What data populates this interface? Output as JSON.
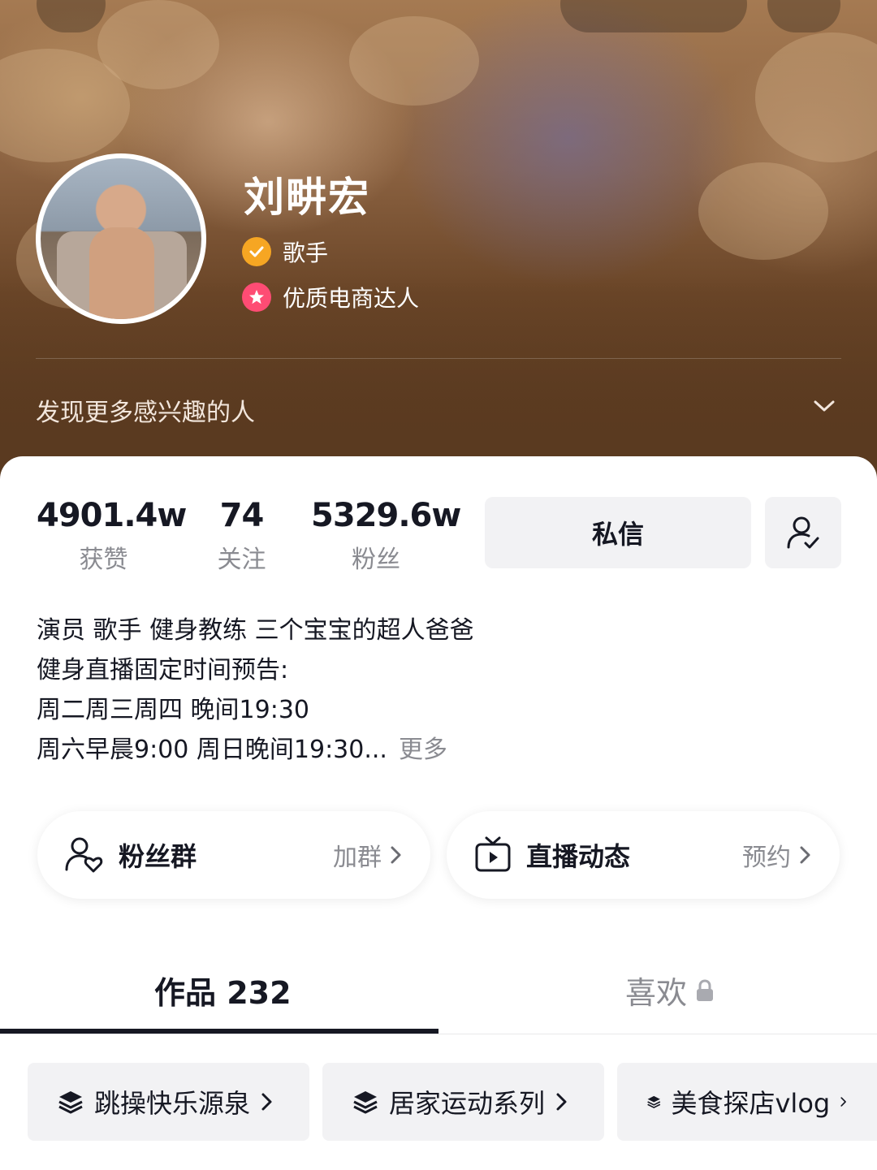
{
  "profile": {
    "name": "刘畊宏",
    "tags": [
      "歌手",
      "优质电商达人"
    ],
    "discover_label": "发现更多感兴趣的人"
  },
  "stats": [
    {
      "value": "4901.4w",
      "label": "获赞"
    },
    {
      "value": "74",
      "label": "关注"
    },
    {
      "value": "5329.6w",
      "label": "粉丝"
    }
  ],
  "actions": {
    "message_label": "私信"
  },
  "bio": {
    "lines": [
      "演员 歌手 健身教练 三个宝宝的超人爸爸",
      "健身直播固定时间预告:",
      "周二周三周四 晚间19:30",
      "周六早晨9:00 周日晚间19:30..."
    ],
    "more_label": "更多"
  },
  "cards": [
    {
      "title": "粉丝群",
      "action": "加群",
      "icon": "fan-group-icon"
    },
    {
      "title": "直播动态",
      "action": "预约",
      "icon": "live-tv-icon"
    }
  ],
  "tabs": [
    {
      "label": "作品 232"
    },
    {
      "label": "喜欢",
      "icon": "lock-icon"
    }
  ],
  "collections": [
    {
      "label": "跳操快乐源泉"
    },
    {
      "label": "居家运动系列"
    },
    {
      "label": "美食探店vlog"
    }
  ],
  "colors": {
    "verified": "#f6a623",
    "merchant": "#fe4c74",
    "text_primary": "#161823",
    "text_secondary": "#8a8b91"
  }
}
